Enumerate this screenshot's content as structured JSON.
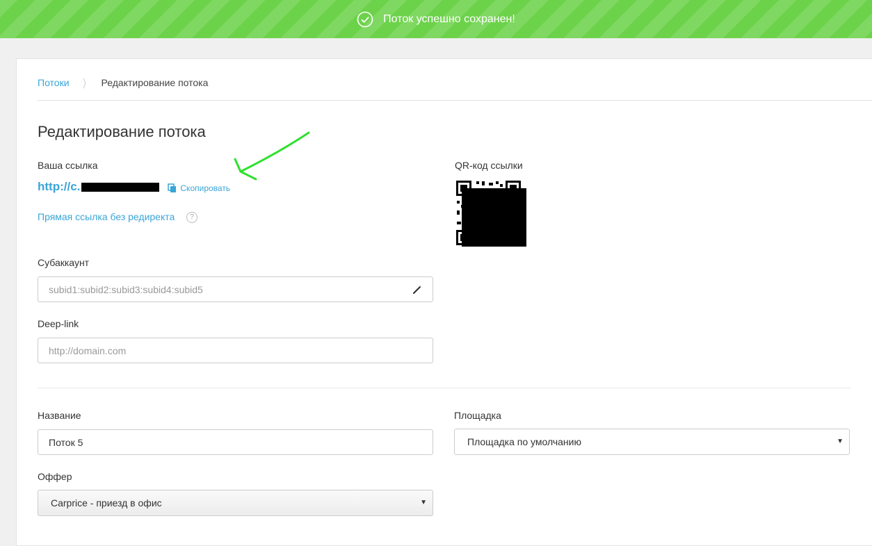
{
  "banner": {
    "message": "Поток успешно сохранен!",
    "icon": "check-circle-icon",
    "color": "#6cd24a"
  },
  "breadcrumb": {
    "parent": "Потоки",
    "current": "Редактирование потока"
  },
  "page": {
    "title": "Редактирование потока"
  },
  "link": {
    "label": "Ваша ссылка",
    "url_visible": "http://c.",
    "copy_label": "Скопировать",
    "direct_link_label": "Прямая ссылка без редиректа",
    "help_symbol": "?"
  },
  "qr": {
    "label": "QR-код ссылки"
  },
  "subaccount": {
    "label": "Субаккаунт",
    "placeholder": "subid1:subid2:subid3:subid4:subid5",
    "value": ""
  },
  "deeplink": {
    "label": "Deep-link",
    "placeholder": "http://domain.com",
    "value": ""
  },
  "name": {
    "label": "Название",
    "value": "Поток 5"
  },
  "platform": {
    "label": "Площадка",
    "selected": "Площадка по умолчанию"
  },
  "offer": {
    "label": "Оффер",
    "selected": "Carprice - приезд в офис"
  },
  "colors": {
    "accent": "#3aa5d8",
    "annotation_arrow": "#2ee02e"
  }
}
